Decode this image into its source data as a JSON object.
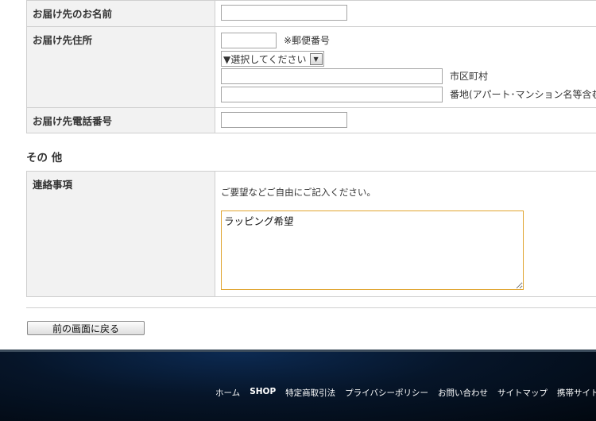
{
  "form": {
    "name_label": "お届け先のお名前",
    "name_value": "",
    "address_label": "お届け先住所",
    "postal_value": "",
    "postal_note": "※郵便番号",
    "prefecture_selected": "▼選択してください",
    "city_value": "",
    "city_note": "市区町村",
    "street_value": "",
    "street_note": "番地(アパート･マンション名等含む)",
    "tel_label": "お届け先電話番号",
    "tel_value": ""
  },
  "other": {
    "section_title": "その 他",
    "note_label": "連絡事項",
    "note_hint": "ご要望などご自由にご記入ください。",
    "note_value": "ラッピング希望"
  },
  "back_button": "前の画面に戻る",
  "footer": {
    "links": [
      "ホーム",
      "SHOP",
      "特定商取引法",
      "プライバシーポリシー",
      "お問い合わせ",
      "サイトマップ",
      "携帯サイト"
    ]
  },
  "colors": {
    "label_bg": "#f2f2f2",
    "border": "#cfcfcf",
    "textarea_focus": "#e0a42e",
    "footer_bg": "#061529"
  }
}
